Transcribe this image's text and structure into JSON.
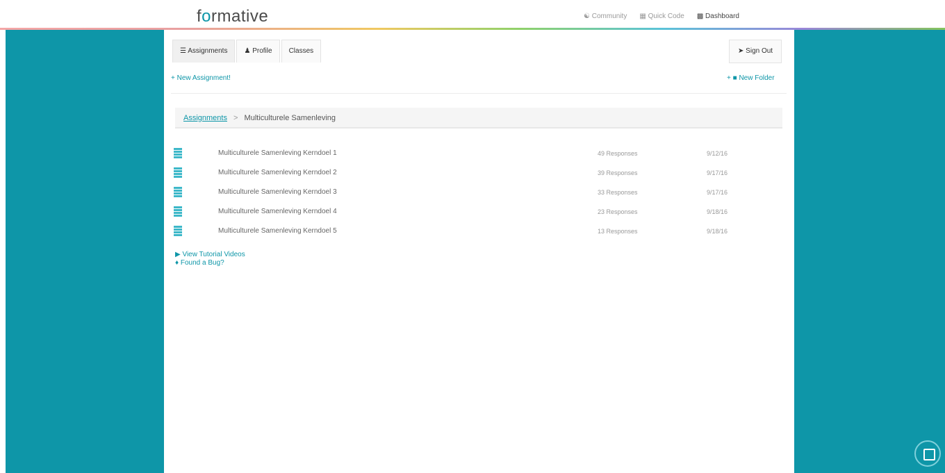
{
  "header": {
    "logo_text_pre": "f",
    "logo_text_o": "o",
    "logo_text_post": "rmative",
    "nav": [
      {
        "label": "Community",
        "icon": "users-icon"
      },
      {
        "label": "Quick Code",
        "icon": "code-icon"
      },
      {
        "label": "Dashboard",
        "icon": "dashboard-icon"
      }
    ]
  },
  "tabs": {
    "assignments": "Assignments",
    "profile": "Profile",
    "classes": "Classes"
  },
  "signout_label": "Sign Out",
  "actions": {
    "new_assignment": "New Assignment!",
    "new_folder": "New Folder"
  },
  "breadcrumb": {
    "root": "Assignments",
    "separator": ">",
    "current": "Multiculturele Samenleving"
  },
  "assignments": [
    {
      "name": "Multiculturele Samenleving Kerndoel 1",
      "responses": "49 Responses",
      "date": "9/12/16"
    },
    {
      "name": "Multiculturele Samenleving Kerndoel 2",
      "responses": "39 Responses",
      "date": "9/17/16"
    },
    {
      "name": "Multiculturele Samenleving Kerndoel 3",
      "responses": "33 Responses",
      "date": "9/17/16"
    },
    {
      "name": "Multiculturele Samenleving Kerndoel 4",
      "responses": "23 Responses",
      "date": "9/18/16"
    },
    {
      "name": "Multiculturele Samenleving Kerndoel 5",
      "responses": "13 Responses",
      "date": "9/18/16"
    }
  ],
  "footer_links": {
    "tutorials": "View Tutorial Videos",
    "bug": "Found a Bug?"
  },
  "colors": {
    "accent": "#0e96a8",
    "background": "#0e96a8"
  }
}
